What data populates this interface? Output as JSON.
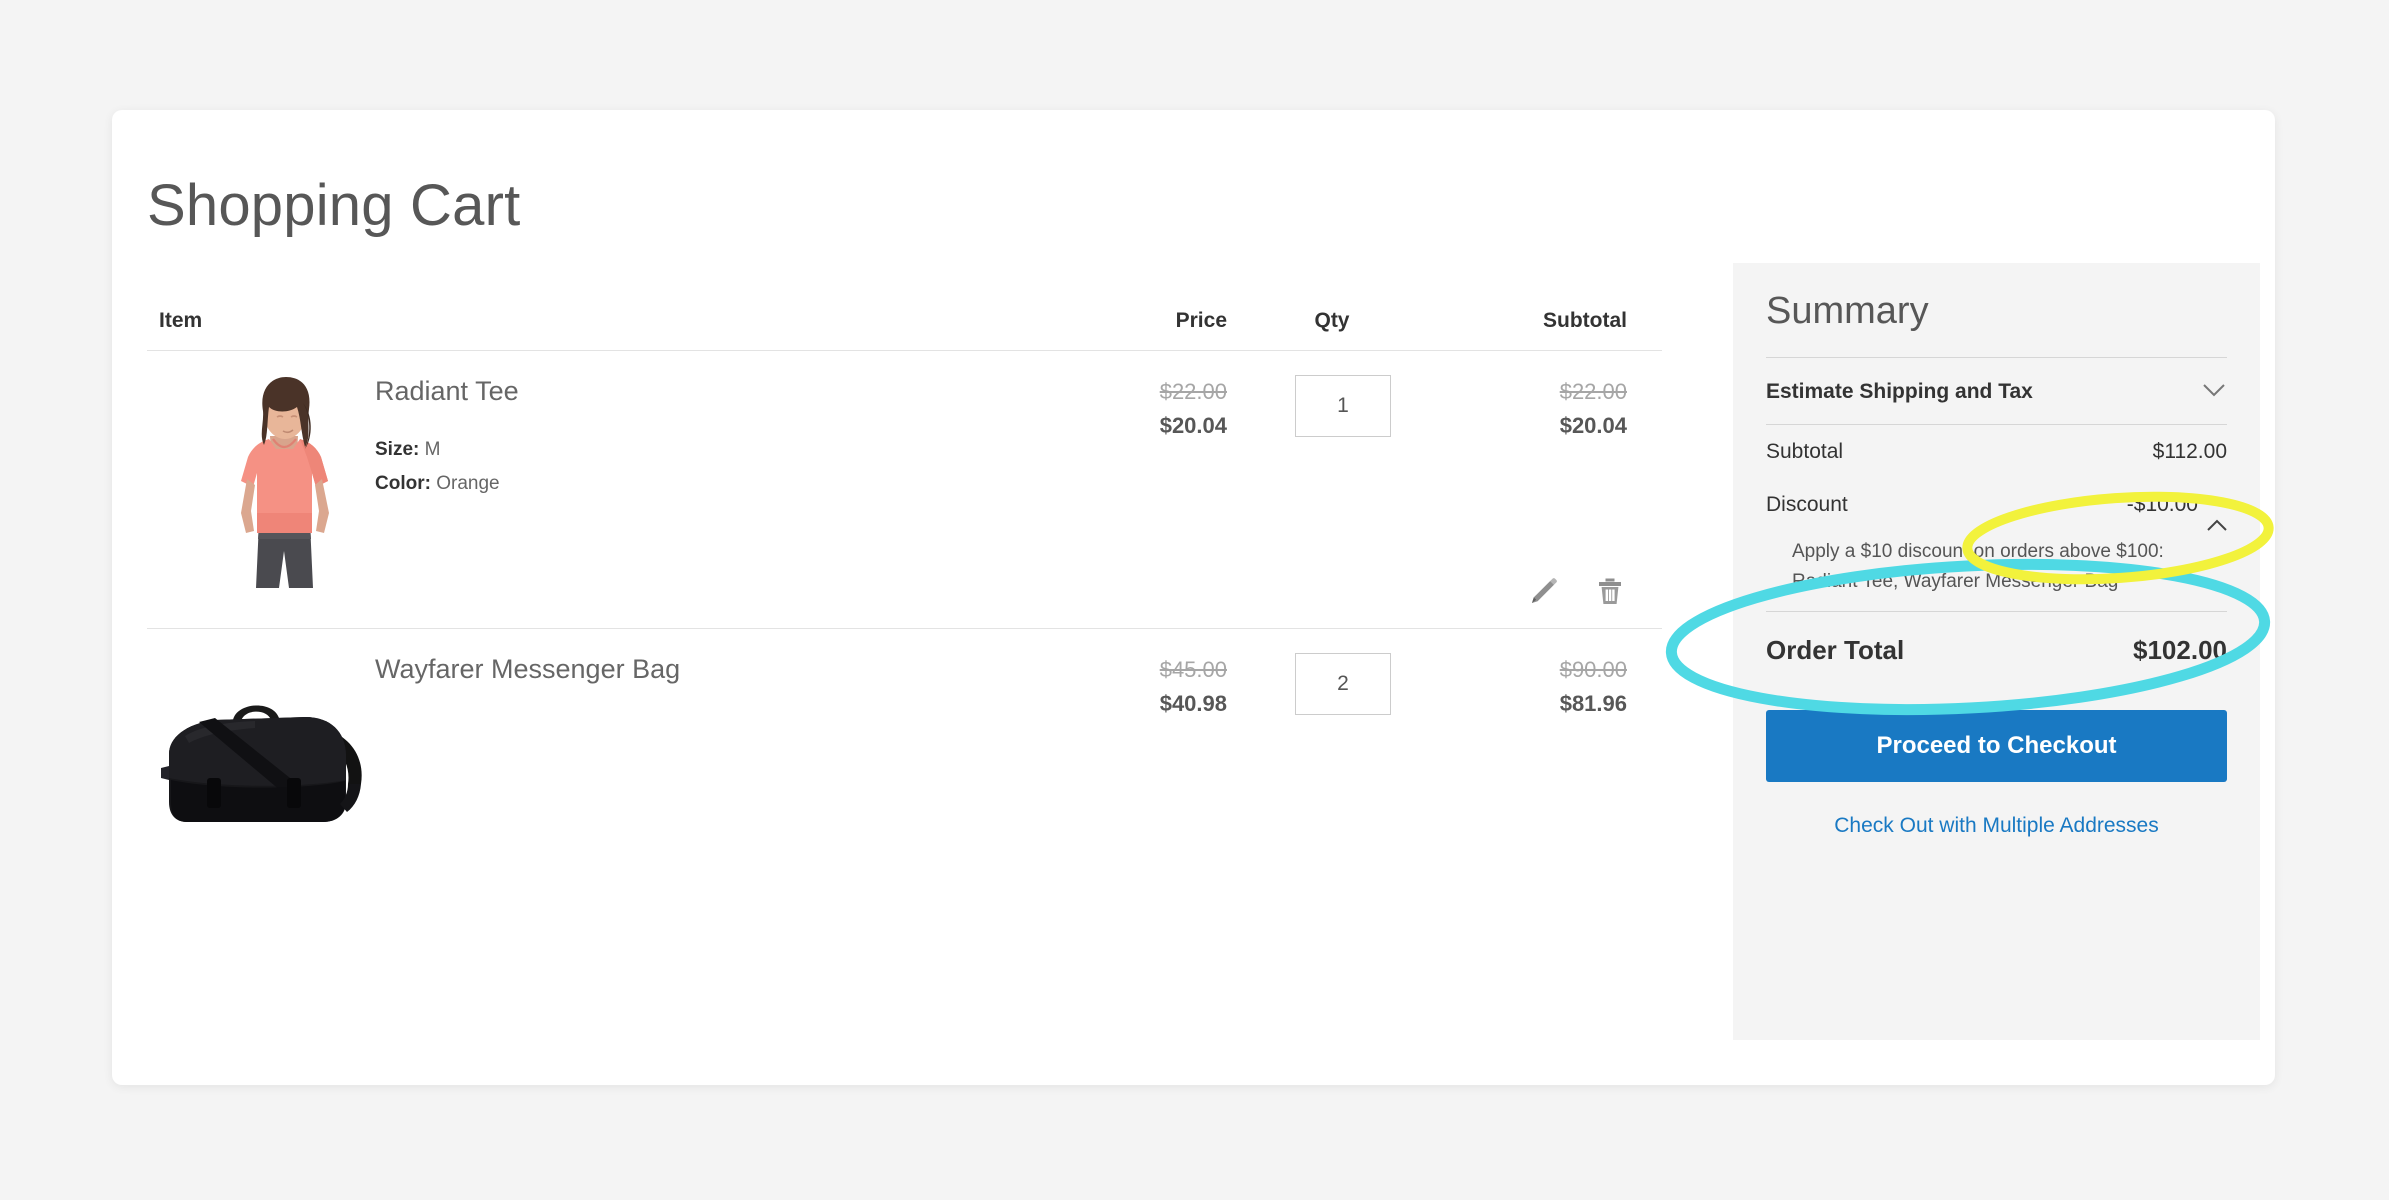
{
  "page": {
    "title": "Shopping Cart",
    "background_color": "#f4f4f4",
    "card_background": "#ffffff"
  },
  "table": {
    "headers": {
      "item": "Item",
      "price": "Price",
      "qty": "Qty",
      "subtotal": "Subtotal"
    },
    "rows": [
      {
        "name": "Radiant Tee",
        "image": "radiant-tee-photo",
        "options": [
          {
            "label": "Size:",
            "value": "M"
          },
          {
            "label": "Color:",
            "value": "Orange"
          }
        ],
        "price_old": "$22.00",
        "price_new": "$20.04",
        "qty": "1",
        "subtotal_old": "$22.00",
        "subtotal_new": "$20.04",
        "actions": {
          "edit": "edit-item",
          "delete": "remove-item"
        }
      },
      {
        "name": "Wayfarer Messenger Bag",
        "image": "wayfarer-messenger-bag-photo",
        "options": [],
        "price_old": "$45.00",
        "price_new": "$40.98",
        "qty": "2",
        "subtotal_old": "$90.00",
        "subtotal_new": "$81.96",
        "actions": {}
      }
    ]
  },
  "summary": {
    "title": "Summary",
    "estimate_label": "Estimate Shipping and Tax",
    "estimate_expanded": false,
    "totals": [
      {
        "label": "Subtotal",
        "value": "$112.00"
      },
      {
        "label": "Discount",
        "value": "-$10.00"
      }
    ],
    "discount_detail": "Apply a $10 discount on orders above $100: Radiant Tee, Wayfarer Messenger Bag",
    "order_total_label": "Order Total",
    "order_total_value": "$102.00",
    "checkout_button": "Proceed to Checkout",
    "multi_address_link": "Check Out with Multiple Addresses",
    "accent_color": "#1979c3",
    "panel_color": "#f4f4f4"
  },
  "annotations": [
    {
      "id": "discount-value-highlight",
      "shape": "ellipse",
      "color": "#f2f23c",
      "target": "Discount value -$10.00 and collapse caret"
    },
    {
      "id": "discount-detail-highlight",
      "shape": "ellipse",
      "color": "#4fd9e4",
      "target": "Discount rule description text"
    }
  ]
}
